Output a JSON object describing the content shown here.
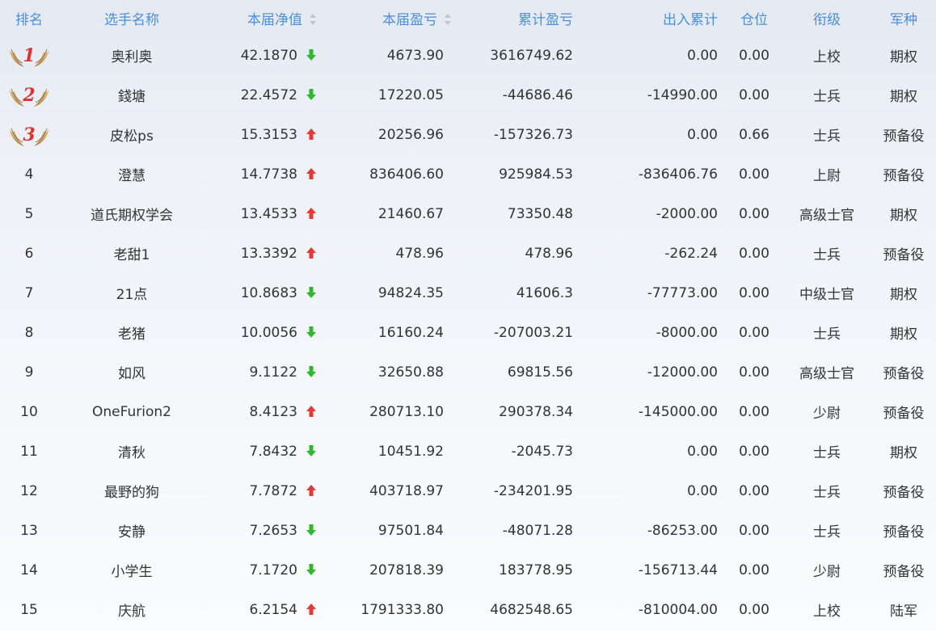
{
  "header": {
    "rank": "排名",
    "name": "选手名称",
    "net_value": "本届净值",
    "profit": "本届盈亏",
    "cumulative_profit": "累计盈亏",
    "inout": "出入累计",
    "position": "仓位",
    "title": "衔级",
    "branch": "军种"
  },
  "colors": {
    "header_text": "#4a90d9",
    "up_arrow": "#e53935",
    "down_arrow": "#2eb82e",
    "medal_gold": "#c9a063",
    "medal_number": "#e03030"
  },
  "rows": [
    {
      "rank": "1",
      "medal": true,
      "name": "奥利奥",
      "net_value": "42.1870",
      "trend": "down",
      "profit": "4673.90",
      "cumulative": "3616749.62",
      "inout": "0.00",
      "position": "0.00",
      "title": "上校",
      "branch": "期权"
    },
    {
      "rank": "2",
      "medal": true,
      "name": "錢塘",
      "net_value": "22.4572",
      "trend": "down",
      "profit": "17220.05",
      "cumulative": "-44686.46",
      "inout": "-14990.00",
      "position": "0.00",
      "title": "士兵",
      "branch": "期权"
    },
    {
      "rank": "3",
      "medal": true,
      "name": "皮松ps",
      "net_value": "15.3153",
      "trend": "up",
      "profit": "20256.96",
      "cumulative": "-157326.73",
      "inout": "0.00",
      "position": "0.66",
      "title": "士兵",
      "branch": "预备役"
    },
    {
      "rank": "4",
      "medal": false,
      "name": "澄慧",
      "net_value": "14.7738",
      "trend": "up",
      "profit": "836406.60",
      "cumulative": "925984.53",
      "inout": "-836406.76",
      "position": "0.00",
      "title": "上尉",
      "branch": "预备役"
    },
    {
      "rank": "5",
      "medal": false,
      "name": "道氏期权学会",
      "net_value": "13.4533",
      "trend": "up",
      "profit": "21460.67",
      "cumulative": "73350.48",
      "inout": "-2000.00",
      "position": "0.00",
      "title": "高级士官",
      "branch": "期权"
    },
    {
      "rank": "6",
      "medal": false,
      "name": "老甜1",
      "net_value": "13.3392",
      "trend": "up",
      "profit": "478.96",
      "cumulative": "478.96",
      "inout": "-262.24",
      "position": "0.00",
      "title": "士兵",
      "branch": "预备役"
    },
    {
      "rank": "7",
      "medal": false,
      "name": "21点",
      "net_value": "10.8683",
      "trend": "down",
      "profit": "94824.35",
      "cumulative": "41606.3",
      "inout": "-77773.00",
      "position": "0.00",
      "title": "中级士官",
      "branch": "期权"
    },
    {
      "rank": "8",
      "medal": false,
      "name": "老猪",
      "net_value": "10.0056",
      "trend": "down",
      "profit": "16160.24",
      "cumulative": "-207003.21",
      "inout": "-8000.00",
      "position": "0.00",
      "title": "士兵",
      "branch": "期权"
    },
    {
      "rank": "9",
      "medal": false,
      "name": "如风",
      "net_value": "9.1122",
      "trend": "down",
      "profit": "32650.88",
      "cumulative": "69815.56",
      "inout": "-12000.00",
      "position": "0.00",
      "title": "高级士官",
      "branch": "预备役"
    },
    {
      "rank": "10",
      "medal": false,
      "name": "OneFurion2",
      "net_value": "8.4123",
      "trend": "up",
      "profit": "280713.10",
      "cumulative": "290378.34",
      "inout": "-145000.00",
      "position": "0.00",
      "title": "少尉",
      "branch": "预备役"
    },
    {
      "rank": "11",
      "medal": false,
      "name": "清秋",
      "net_value": "7.8432",
      "trend": "down",
      "profit": "10451.92",
      "cumulative": "-2045.73",
      "inout": "0.00",
      "position": "0.00",
      "title": "士兵",
      "branch": "期权"
    },
    {
      "rank": "12",
      "medal": false,
      "name": "最野的狗",
      "net_value": "7.7872",
      "trend": "up",
      "profit": "403718.97",
      "cumulative": "-234201.95",
      "inout": "0.00",
      "position": "0.00",
      "title": "士兵",
      "branch": "预备役"
    },
    {
      "rank": "13",
      "medal": false,
      "name": "安静",
      "net_value": "7.2653",
      "trend": "down",
      "profit": "97501.84",
      "cumulative": "-48071.28",
      "inout": "-86253.00",
      "position": "0.00",
      "title": "士兵",
      "branch": "预备役"
    },
    {
      "rank": "14",
      "medal": false,
      "name": "小学生",
      "net_value": "7.1720",
      "trend": "down",
      "profit": "207818.39",
      "cumulative": "183778.95",
      "inout": "-156713.44",
      "position": "0.00",
      "title": "少尉",
      "branch": "预备役"
    },
    {
      "rank": "15",
      "medal": false,
      "name": "庆航",
      "net_value": "6.2154",
      "trend": "up",
      "profit": "1791333.80",
      "cumulative": "4682548.65",
      "inout": "-810004.00",
      "position": "0.00",
      "title": "上校",
      "branch": "陆军"
    }
  ]
}
